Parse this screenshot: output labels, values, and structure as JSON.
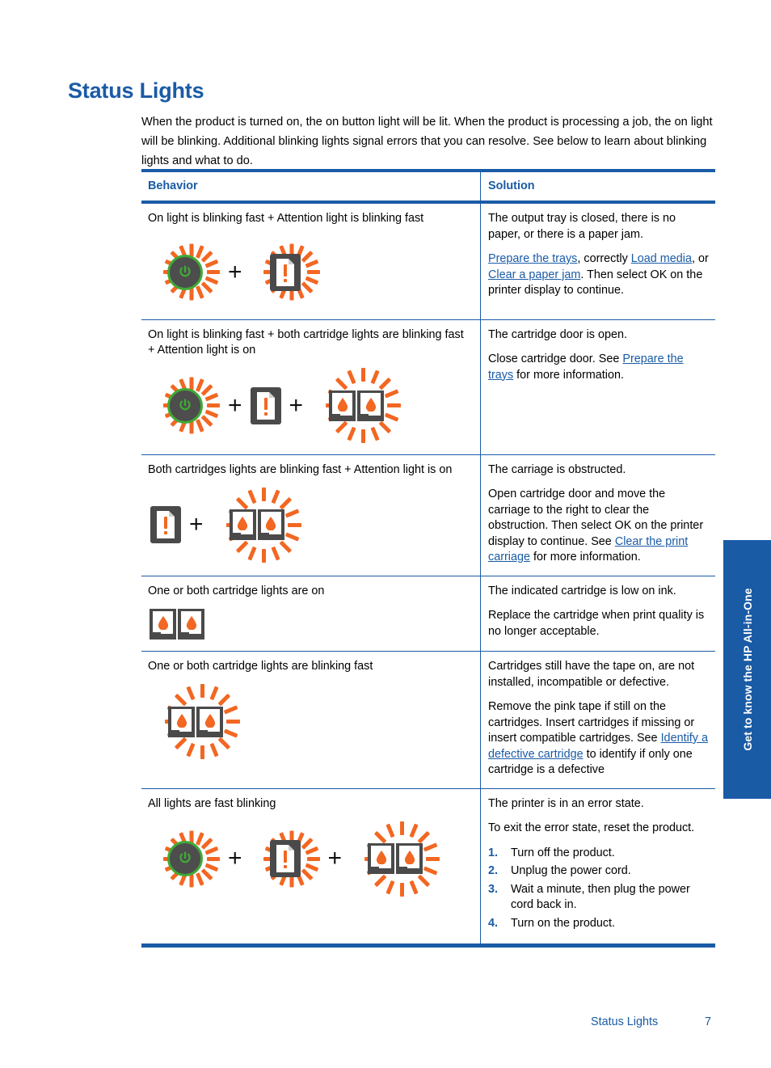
{
  "page": {
    "title": "Status Lights",
    "intro": "When the product is turned on, the on button light will be lit. When the product is processing a job, the on light will be blinking. Additional blinking lights signal errors that you can resolve. See below to learn about blinking lights and what to do.",
    "accent_blue": "#1a5ba6",
    "orange": "#f26722",
    "green": "#3faa35",
    "dark_gray": "#4a4a4a"
  },
  "table": {
    "headers": {
      "behavior": "Behavior",
      "solution": "Solution"
    },
    "rows": [
      {
        "behavior": "On light is blinking fast + Attention light is blinking fast",
        "icons": [
          "power-blinking",
          "plus",
          "attention-blinking"
        ],
        "solution": [
          {
            "type": "paragraph",
            "parts": [
              {
                "text": "The output tray is closed, there is no paper, or there is a paper jam.",
                "link": false
              }
            ]
          },
          {
            "type": "paragraph",
            "parts": [
              {
                "text": "Prepare the trays",
                "link": true
              },
              {
                "text": ", correctly ",
                "link": false
              },
              {
                "text": "Load media",
                "link": true
              },
              {
                "text": ", or ",
                "link": false
              },
              {
                "text": "Clear a paper jam",
                "link": true
              },
              {
                "text": ". Then select OK on the printer display to continue.",
                "link": false
              }
            ]
          }
        ]
      },
      {
        "behavior": "On light is blinking fast + both cartridge lights are blinking fast + Attention light is on",
        "icons": [
          "power-blinking",
          "plus",
          "attention-steady",
          "plus",
          "cartridges-blinking"
        ],
        "solution": [
          {
            "type": "paragraph",
            "parts": [
              {
                "text": "The cartridge door is open.",
                "link": false
              }
            ]
          },
          {
            "type": "paragraph",
            "parts": [
              {
                "text": "Close cartridge door. See ",
                "link": false
              },
              {
                "text": "Prepare the trays",
                "link": true
              },
              {
                "text": " for more information.",
                "link": false
              }
            ]
          }
        ]
      },
      {
        "behavior": "Both cartridges lights are blinking fast + Attention light is on",
        "icons": [
          "attention-steady",
          "plus",
          "cartridges-blinking"
        ],
        "solution": [
          {
            "type": "paragraph",
            "parts": [
              {
                "text": "The carriage is obstructed.",
                "link": false
              }
            ]
          },
          {
            "type": "paragraph",
            "parts": [
              {
                "text": "Open cartridge door and move the carriage to the right to clear the obstruction. Then select OK on the printer display to continue. See ",
                "link": false
              },
              {
                "text": "Clear the print carriage",
                "link": true
              },
              {
                "text": " for more information.",
                "link": false
              }
            ]
          }
        ]
      },
      {
        "behavior": "One or both cartridge lights are on",
        "icons": [
          "cartridges-steady"
        ],
        "solution": [
          {
            "type": "paragraph",
            "parts": [
              {
                "text": "The indicated cartridge is low on ink.",
                "link": false
              }
            ]
          },
          {
            "type": "paragraph",
            "parts": [
              {
                "text": "Replace the cartridge when print quality is no longer acceptable.",
                "link": false
              }
            ]
          }
        ]
      },
      {
        "behavior": "One or both cartridge lights are blinking fast",
        "icons": [
          "cartridges-blinking"
        ],
        "solution": [
          {
            "type": "paragraph",
            "parts": [
              {
                "text": "Cartridges still have the tape on, are not installed, incompatible or defective.",
                "link": false
              }
            ]
          },
          {
            "type": "paragraph",
            "parts": [
              {
                "text": "Remove the pink tape if still on the cartridges. Insert cartridges if missing or insert compatible cartridges. See ",
                "link": false
              },
              {
                "text": "Identify a defective cartridge",
                "link": true
              },
              {
                "text": " to identify if only one cartridge is a defective",
                "link": false
              }
            ]
          }
        ]
      },
      {
        "behavior": "All lights are fast blinking",
        "icons": [
          "power-blinking",
          "plus",
          "attention-blinking",
          "plus",
          "cartridges-blinking"
        ],
        "solution": [
          {
            "type": "paragraph",
            "parts": [
              {
                "text": "The printer is in an error state.",
                "link": false
              }
            ]
          },
          {
            "type": "paragraph",
            "parts": [
              {
                "text": "To exit the error state, reset the product.",
                "link": false
              }
            ]
          },
          {
            "type": "steps",
            "items": [
              {
                "num": "1.",
                "text": "Turn off the product."
              },
              {
                "num": "2.",
                "text": "Unplug the power cord."
              },
              {
                "num": "3.",
                "text": "Wait a minute, then plug the power cord back in."
              },
              {
                "num": "4.",
                "text": "Turn on the product."
              }
            ]
          }
        ]
      }
    ]
  },
  "side_tab": {
    "label": "Get to know the HP All-in-One"
  },
  "footer": {
    "section": "Status Lights",
    "page_number": "7"
  }
}
